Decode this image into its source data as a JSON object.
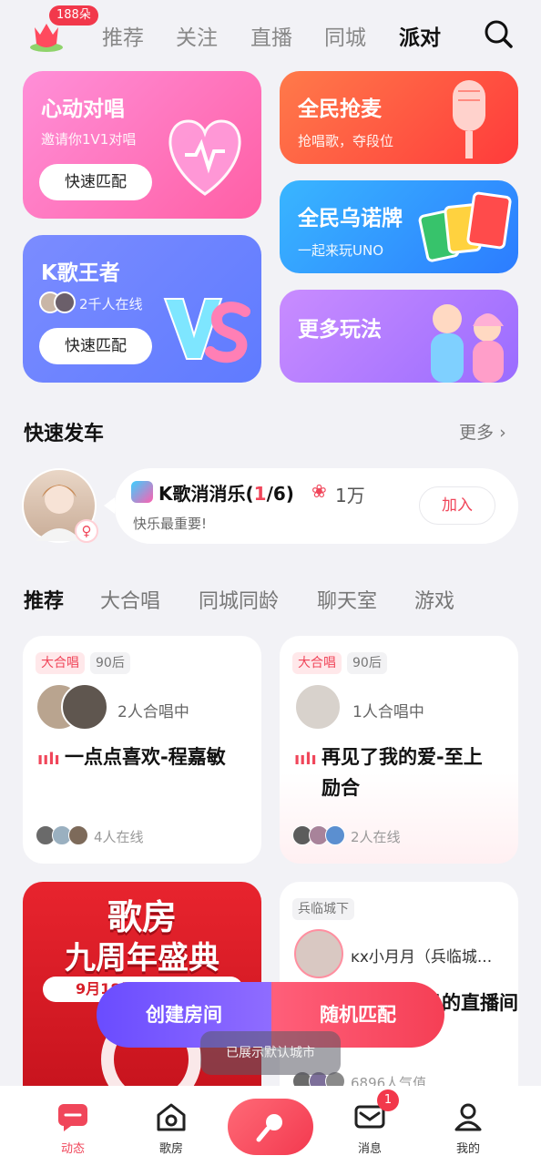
{
  "top": {
    "badge": "188朵",
    "tabs": [
      "推荐",
      "关注",
      "直播",
      "同城",
      "派对"
    ]
  },
  "feature_cards": {
    "duet": {
      "title": "心动对唱",
      "subtitle": "邀请你1V1对唱",
      "button": "快速匹配"
    },
    "mic": {
      "title": "全民抢麦",
      "subtitle": "抢唱歌，夺段位"
    },
    "uno": {
      "title": "全民乌诺牌",
      "subtitle": "一起来玩UNO"
    },
    "king": {
      "title": "K歌王者",
      "online": "2千人在线",
      "button": "快速匹配"
    },
    "more": {
      "title": "更多玩法"
    }
  },
  "quick": {
    "title": "快速发车",
    "more": "更多",
    "game": "K歌消消乐",
    "count_open": "(",
    "count_now": "1",
    "count_rest": "/6)",
    "flowers": "1万",
    "desc": "快乐最重要!",
    "join": "加入"
  },
  "categories": [
    "推荐",
    "大合唱",
    "同城同龄",
    "聊天室",
    "游戏"
  ],
  "rooms": {
    "r1": {
      "tag1": "大合唱",
      "tag2": "90后",
      "status": "2人合唱中",
      "song": "一点点喜欢-程嘉敏",
      "online": "4人在线"
    },
    "r2": {
      "tag1": "大合唱",
      "tag2": "90后",
      "status": "1人合唱中",
      "song_line1": "再见了我的爱-至上",
      "song_line2": "励合",
      "online": "2人在线"
    },
    "r3": {
      "banner_line1": "歌房",
      "banner_line2": "九周年盛典",
      "banner_date": "9月18日"
    },
    "r4": {
      "tag": "兵临城下",
      "host": "ĸx小月月（兵临城...",
      "title": "小月的直播间",
      "popularity": "6896人气值"
    }
  },
  "overlay": {
    "create": "创建房间",
    "random": "随机匹配",
    "toast": "已展示默认城市"
  },
  "nav": {
    "items": [
      "动态",
      "歌房",
      "",
      "消息",
      "我的"
    ],
    "msg_badge": "1"
  },
  "colors": {
    "accent": "#f0465a",
    "primary_text": "#111111",
    "secondary_text": "#777777"
  }
}
